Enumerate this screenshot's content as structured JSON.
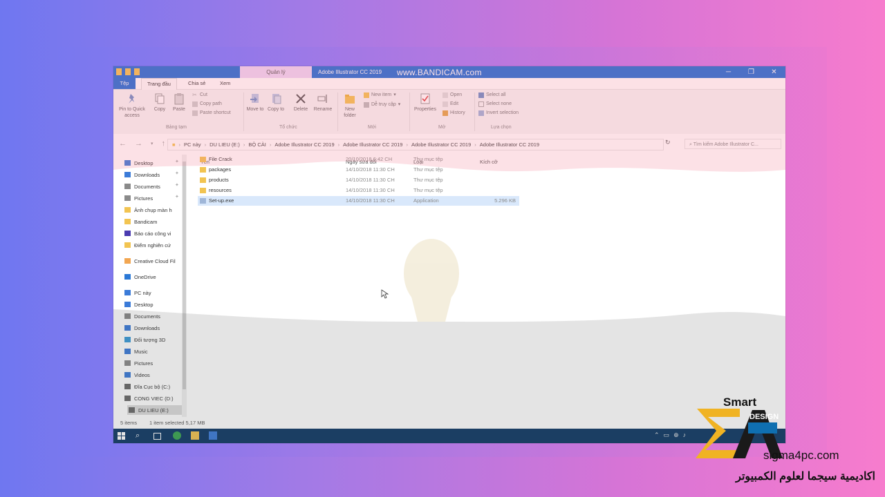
{
  "window": {
    "context_tab": "Quản lý",
    "title": "Adobe Illustrator CC 2019",
    "watermark": "www.BANDICAM.com",
    "controls": [
      "─",
      "❐",
      "✕"
    ]
  },
  "ribbon_tabs": [
    "Tệp",
    "Trang đầu",
    "Chia sẻ",
    "Xem"
  ],
  "ribbon": {
    "pin_to_quick_access": "Pin to Quick access",
    "copy": "Copy",
    "paste": "Paste",
    "cut": "Cut",
    "copy_path": "Copy path",
    "paste_shortcut": "Paste shortcut",
    "group_clipboard": "Bảng tạm",
    "move_to": "Move to",
    "copy_to": "Copy to",
    "delete": "Delete",
    "rename": "Rename",
    "group_organize": "Tổ chức",
    "new_folder": "New folder",
    "new_item": "New item",
    "easy_access": "Dễ truy cập",
    "group_new": "Mới",
    "properties": "Properties",
    "open": "Open",
    "edit": "Edit",
    "history": "History",
    "group_open": "Mở",
    "select_all": "Select all",
    "select_none": "Select none",
    "invert_selection": "Invert selection",
    "group_select": "Lựa chọn"
  },
  "address": {
    "crumbs": [
      "PC này",
      "DU LIEU (E:)",
      "BỘ CÀI",
      "Adobe Illustrator CC 2019",
      "Adobe Illustrator CC 2019",
      "Adobe Illustrator CC 2019",
      "Adobe Illustrator CC 2019"
    ],
    "search_placeholder": "Tìm kiếm Adobe Illustrator C..."
  },
  "nav": [
    {
      "label": "Desktop",
      "icon": "desktop-icon",
      "color": "#3b7bd8",
      "pinned": true
    },
    {
      "label": "Downloads",
      "icon": "download-icon",
      "color": "#3b7bd8",
      "pinned": true
    },
    {
      "label": "Documents",
      "icon": "documents-icon",
      "color": "#8a8a8a",
      "pinned": true
    },
    {
      "label": "Pictures",
      "icon": "pictures-icon",
      "color": "#8a8a8a",
      "pinned": true
    },
    {
      "label": "Ảnh chụp màn h",
      "icon": "folder-icon",
      "color": "#f2c451"
    },
    {
      "label": "Bandicam",
      "icon": "folder-icon",
      "color": "#f2c451"
    },
    {
      "label": "Báo cáo công vi",
      "icon": "app-icon",
      "color": "#4a3bb0"
    },
    {
      "label": "Điểm nghiên cứ",
      "icon": "folder-icon",
      "color": "#f2c451"
    },
    {
      "label": "Creative Cloud Fil",
      "icon": "cloud-folder-icon",
      "color": "#f2a651"
    },
    {
      "label": "OneDrive",
      "icon": "onedrive-icon",
      "color": "#2a78d6"
    },
    {
      "label": "PC này",
      "icon": "pc-icon",
      "color": "#3b7bd8"
    },
    {
      "label": "Desktop",
      "icon": "desktop-icon",
      "color": "#3b7bd8"
    },
    {
      "label": "Documents",
      "icon": "documents-icon",
      "color": "#8a8a8a"
    },
    {
      "label": "Downloads",
      "icon": "download-icon",
      "color": "#3b7bd8"
    },
    {
      "label": "Đối tượng 3D",
      "icon": "3d-objects-icon",
      "color": "#3b9bd8"
    },
    {
      "label": "Music",
      "icon": "music-icon",
      "color": "#3b7bd8"
    },
    {
      "label": "Pictures",
      "icon": "pictures-icon",
      "color": "#8a8a8a"
    },
    {
      "label": "Videos",
      "icon": "videos-icon",
      "color": "#3b7bd8"
    },
    {
      "label": "Đĩa Cục bộ (C:)",
      "icon": "drive-icon",
      "color": "#6a6a6a"
    },
    {
      "label": "CONG VIEC (D:)",
      "icon": "drive-icon",
      "color": "#6a6a6a"
    },
    {
      "label": "DU LIEU (E:)",
      "icon": "drive-icon",
      "color": "#6a6a6a",
      "selected": true
    }
  ],
  "columns": {
    "name": "Tên",
    "date": "Ngày sửa đổi",
    "type": "Loại",
    "size": "Kích cỡ"
  },
  "files": [
    {
      "name": "File Crack",
      "date": "20/10/2018 6:42 CH",
      "type": "Thư mục tệp",
      "size": "",
      "kind": "folder"
    },
    {
      "name": "packages",
      "date": "14/10/2018 11:30 CH",
      "type": "Thư mục tệp",
      "size": "",
      "kind": "folder"
    },
    {
      "name": "products",
      "date": "14/10/2018 11:30 CH",
      "type": "Thư mục tệp",
      "size": "",
      "kind": "folder"
    },
    {
      "name": "resources",
      "date": "14/10/2018 11:30 CH",
      "type": "Thư mục tệp",
      "size": "",
      "kind": "folder"
    },
    {
      "name": "Set-up.exe",
      "date": "14/10/2018 11:30 CH",
      "type": "Application",
      "size": "5.296 KB",
      "kind": "exe",
      "selected": true
    }
  ],
  "status": {
    "items": "5 items",
    "selected": "1 item selected  5,17 MB"
  },
  "branding": {
    "smart": "Smart",
    "design": "DESIGN",
    "site": "sigma4pc.com",
    "arabic": "اكاديمية سيجما لعلوم الكمبيوتر"
  },
  "colors": {
    "accent": "#1f6fd6",
    "taskbar": "#103a66",
    "logo_gold": "#f0b323"
  }
}
